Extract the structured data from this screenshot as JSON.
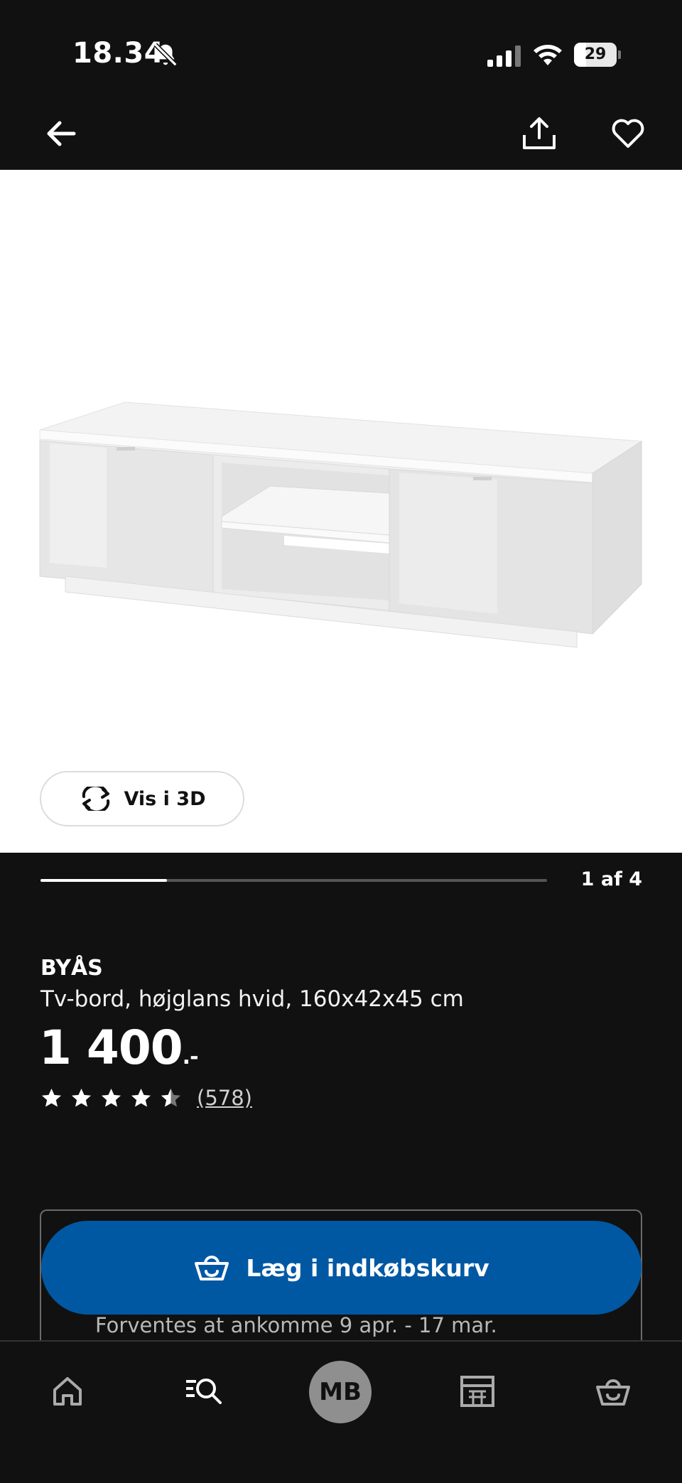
{
  "status_bar": {
    "time": "18.34",
    "battery": "29",
    "battery_level": 0.29,
    "icons": [
      "bell-muted-icon",
      "signal-icon",
      "wifi-icon",
      "battery-icon"
    ]
  },
  "top_nav": {
    "icons": [
      "arrow-left-icon",
      "share-icon",
      "heart-icon"
    ]
  },
  "gallery": {
    "view_3d_label": "Vis i 3D",
    "pager_text": "1 af 4",
    "current": 1,
    "total": 4
  },
  "product": {
    "name": "BYÅS",
    "description": "Tv-bord, højglans hvid, 160x42x45 cm",
    "price": "1 400",
    "price_suffix": ".-",
    "rating": 4.5,
    "review_count": "(578)"
  },
  "cart": {
    "button_label": "Læg i indkøbskurv",
    "delivery_text": "Forventes at ankomme 9 apr. - 17 mar."
  },
  "bottom_nav": {
    "profile_initials": "MB",
    "icons": [
      "home-icon",
      "search-icon",
      "avatar",
      "store-icon",
      "basket-icon"
    ]
  },
  "colors": {
    "background": "#111111",
    "accent_blue": "#0058a3",
    "image_bg": "#ffffff"
  }
}
